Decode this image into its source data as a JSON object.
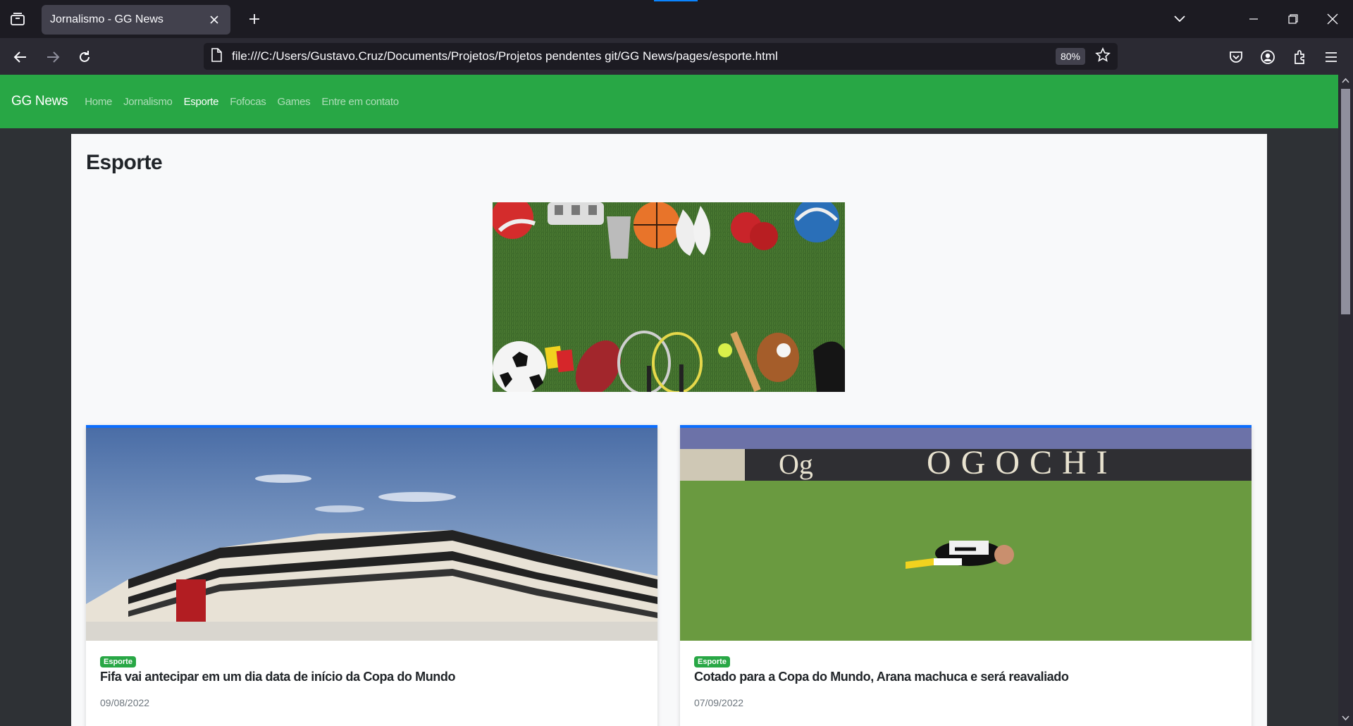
{
  "browser": {
    "tab_title": "Jornalismo - GG News",
    "url": "file:///C:/Users/Gustavo.Cruz/Documents/Projetos/Projetos pendentes git/GG News/pages/esporte.html",
    "zoom": "80%"
  },
  "site": {
    "brand": "GG News",
    "nav": [
      {
        "label": "Home"
      },
      {
        "label": "Jornalismo"
      },
      {
        "label": "Esporte"
      },
      {
        "label": "Fofocas"
      },
      {
        "label": "Games"
      },
      {
        "label": "Entre em contato"
      }
    ],
    "active_nav": "Esporte"
  },
  "page": {
    "title": "Esporte"
  },
  "cards": [
    {
      "badge": "Esporte",
      "title": "Fifa vai antecipar em um dia data de início da Copa do Mundo",
      "date": "09/08/2022"
    },
    {
      "badge": "Esporte",
      "title": "Cotado para a Copa do Mundo, Arana machuca e será reavaliado",
      "date": "07/09/2022"
    }
  ],
  "colors": {
    "site_nav": "#28a745",
    "card_accent": "#0d6efd",
    "badge": "#28a745"
  }
}
